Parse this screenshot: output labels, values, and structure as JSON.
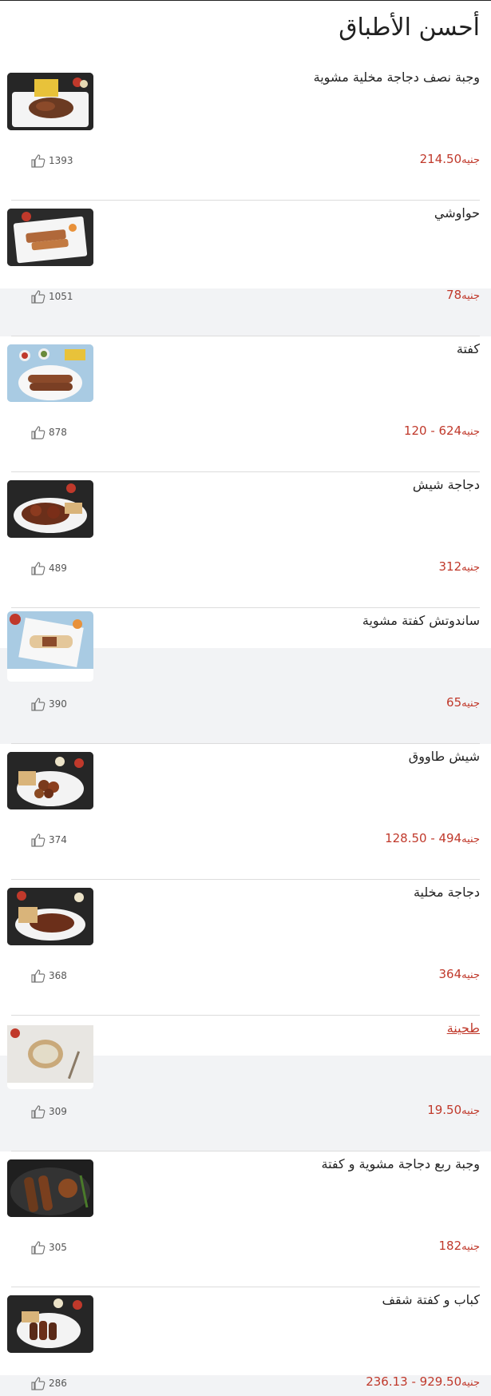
{
  "page": {
    "title": "أحسن الأطباق"
  },
  "dishes": [
    {
      "name": "وجبة نصف دجاجة مخلية مشوية",
      "price": "214.50",
      "currency": "جنيه",
      "likes": "1393",
      "image": "half-grilled-chicken-meal"
    },
    {
      "name": "حواوشي",
      "price": "78",
      "currency": "جنيه",
      "likes": "1051",
      "image": "hawawshi"
    },
    {
      "name": "كفتة",
      "price": "120 - 624",
      "currency": "جنيه",
      "likes": "878",
      "image": "kofta"
    },
    {
      "name": "دجاجة شيش",
      "price": "312",
      "currency": "جنيه",
      "likes": "489",
      "image": "shish-chicken"
    },
    {
      "name": "ساندوتش كفتة مشوية",
      "price": "65",
      "currency": "جنيه",
      "likes": "390",
      "image": "kofta-sandwich"
    },
    {
      "name": "شيش طاووق",
      "price": "128.50 - 494",
      "currency": "جنيه",
      "likes": "374",
      "image": "shish-tawook"
    },
    {
      "name": "دجاجة مخلية",
      "price": "364",
      "currency": "جنيه",
      "likes": "368",
      "image": "boneless-chicken"
    },
    {
      "name": "طحينة",
      "price": "19.50",
      "currency": "جنيه",
      "likes": "309",
      "image": "tahini"
    },
    {
      "name": "وجبة ربع دجاجة مشوية و كفتة",
      "price": "182",
      "currency": "جنيه",
      "likes": "305",
      "image": "quarter-chicken-kofta"
    },
    {
      "name": "كباب و كفتة شقف",
      "price": "236.13 - 929.50",
      "currency": "جنيه",
      "likes": "286",
      "image": "kebab-kofta"
    }
  ],
  "colors": {
    "price": "#c0392b",
    "shade": "#f2f3f5",
    "divider": "#dcdcdc"
  }
}
